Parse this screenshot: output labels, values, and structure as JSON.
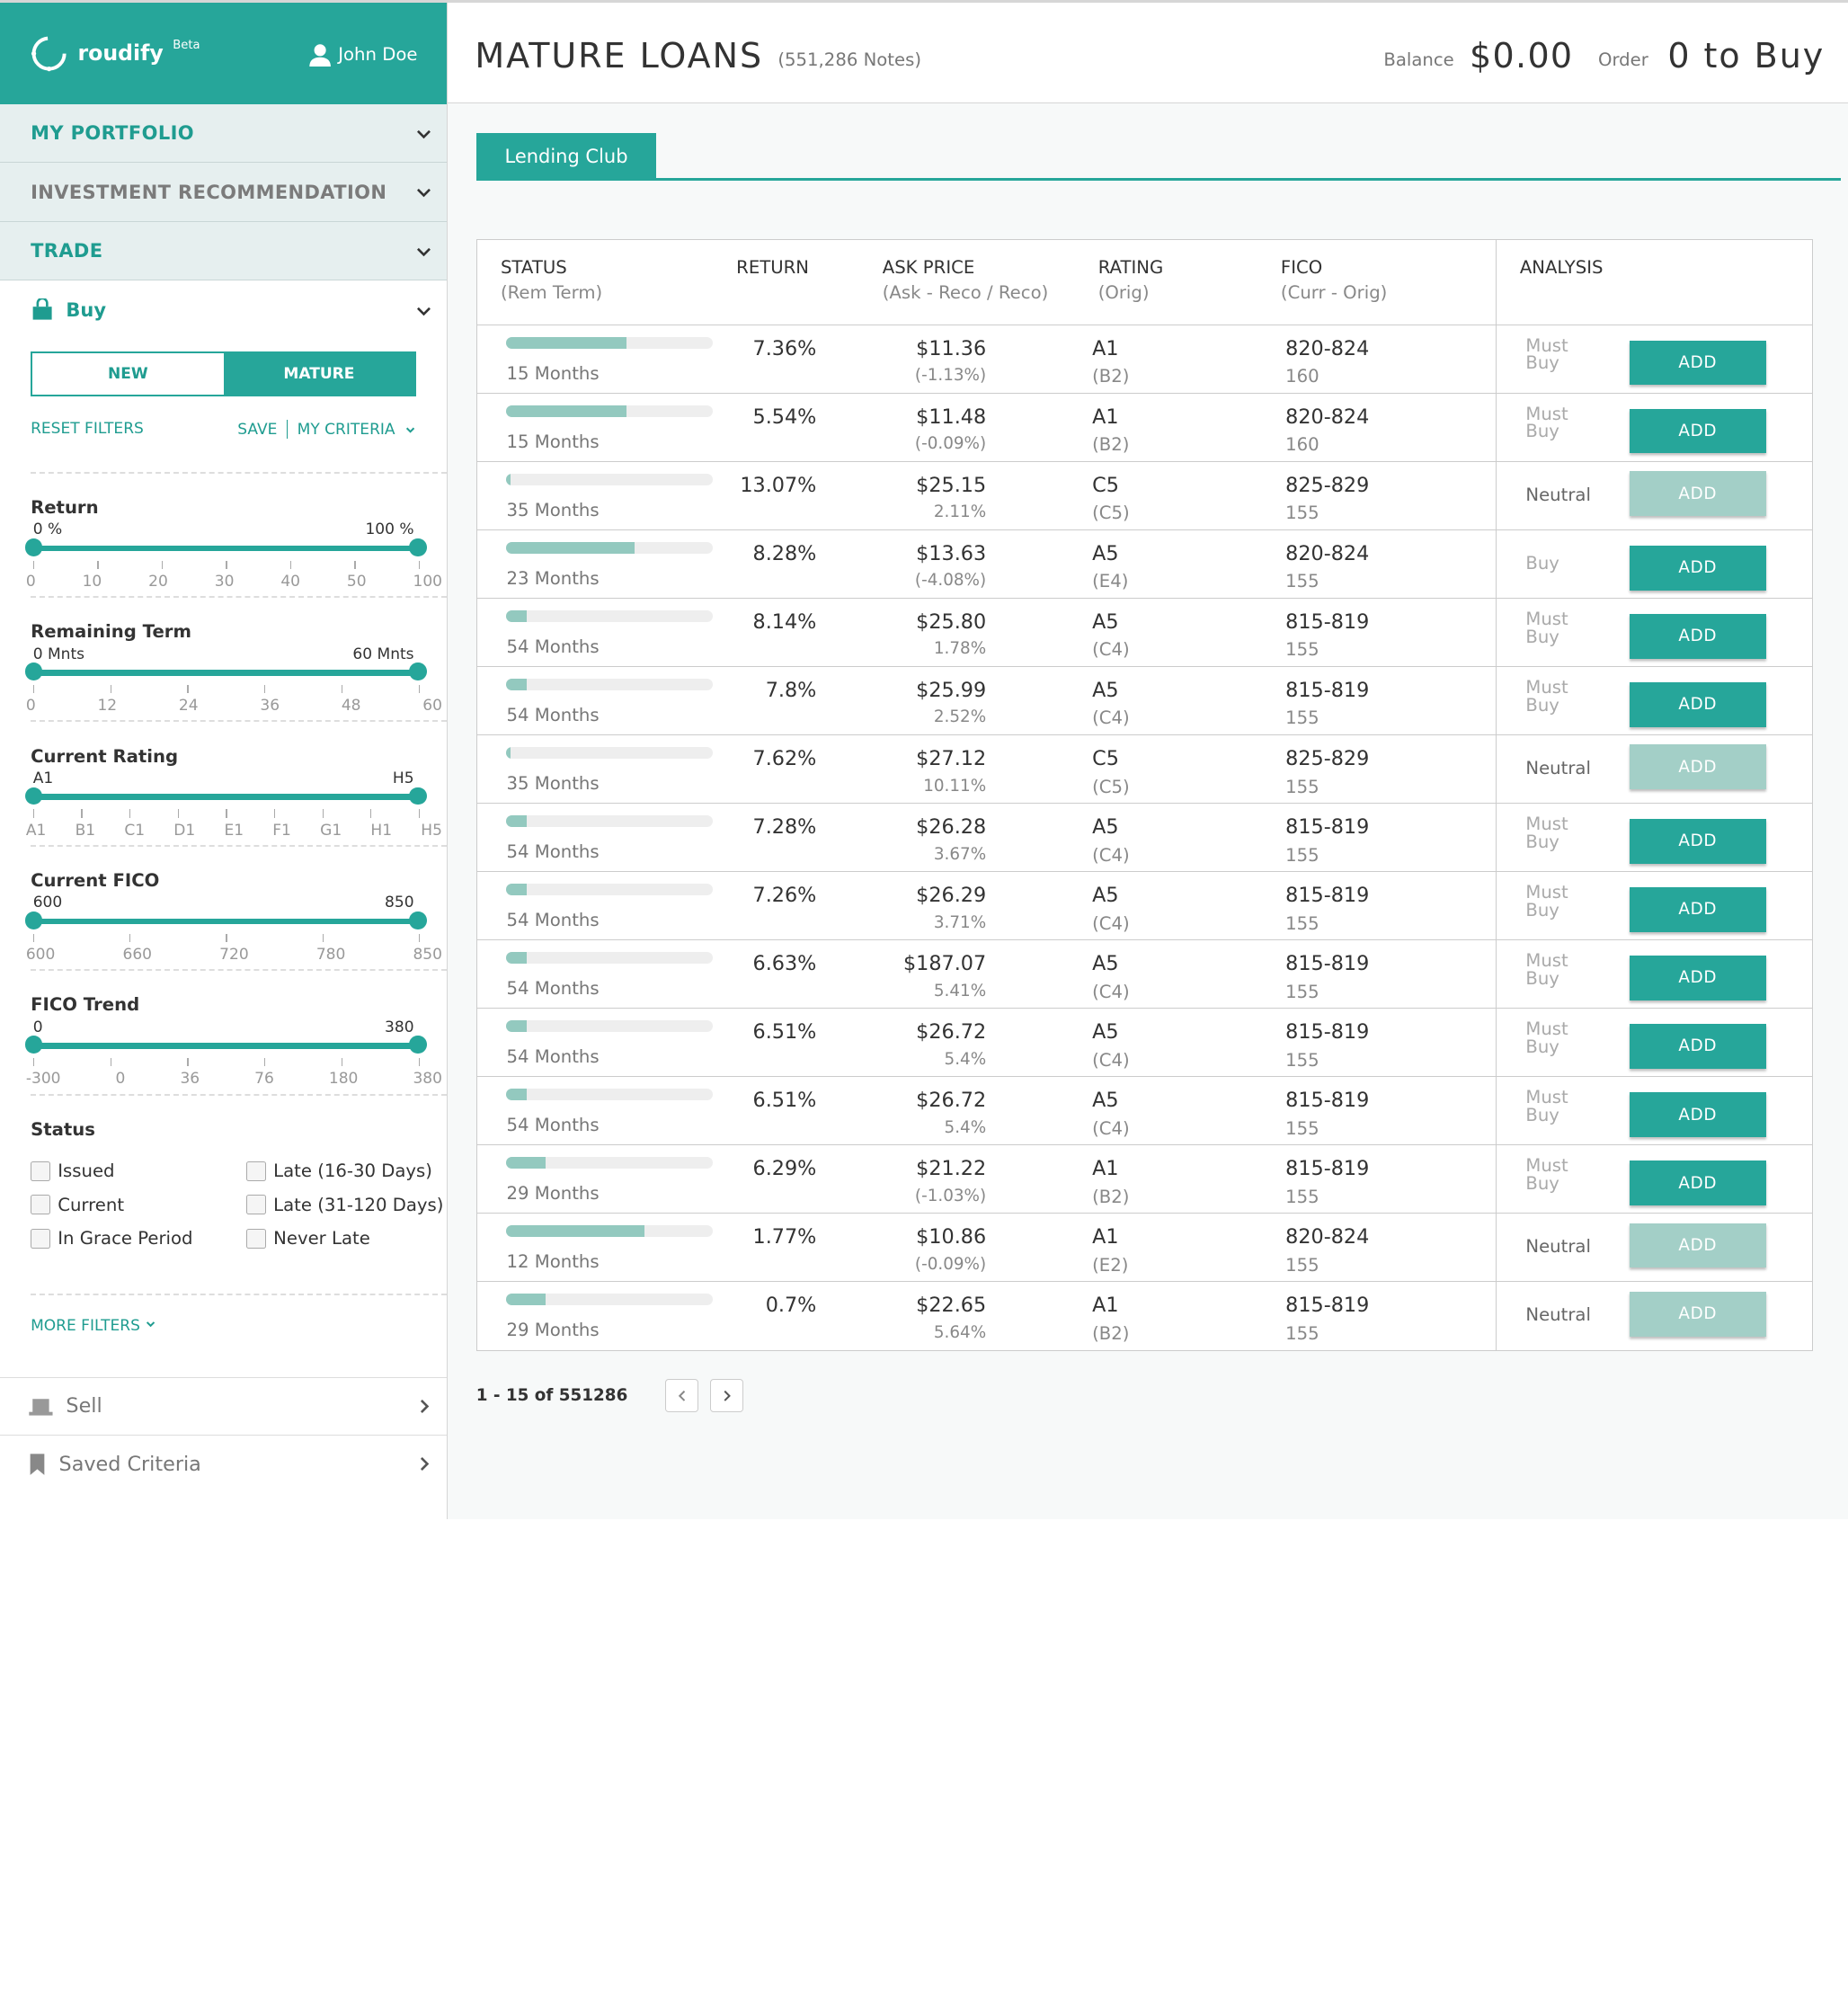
{
  "brand": {
    "name": "roudify",
    "beta": "Beta"
  },
  "user": {
    "name": "John Doe"
  },
  "nav": {
    "portfolio": "MY PORTFOLIO",
    "recommendation": "INVESTMENT RECOMMENDATION",
    "trade": "TRADE",
    "buy": "Buy",
    "sell": "Sell",
    "saved": "Saved Criteria"
  },
  "toggle": {
    "new": "NEW",
    "mature": "MATURE"
  },
  "filters": {
    "reset": "RESET FILTERS",
    "save": "SAVE",
    "criteria": "MY CRITERIA",
    "more": "MORE FILTERS"
  },
  "sliders": [
    {
      "title": "Return",
      "min": "0 %",
      "max": "100 %",
      "labels": [
        "0",
        "10",
        "20",
        "30",
        "40",
        "50",
        "100"
      ]
    },
    {
      "title": "Remaining Term",
      "min": "0 Mnts",
      "max": "60 Mnts",
      "labels": [
        "0",
        "12",
        "24",
        "36",
        "48",
        "60"
      ]
    },
    {
      "title": "Current Rating",
      "min": "A1",
      "max": "H5",
      "labels": [
        "A1",
        "B1",
        "C1",
        "D1",
        "E1",
        "F1",
        "G1",
        "H1",
        "H5"
      ]
    },
    {
      "title": "Current FICO",
      "min": "600",
      "max": "850",
      "labels": [
        "600",
        "660",
        "720",
        "780",
        "850"
      ]
    },
    {
      "title": "FICO Trend",
      "min": "0",
      "max": "380",
      "labels": [
        "-300",
        "0",
        "36",
        "76",
        "180",
        "380"
      ]
    }
  ],
  "status": {
    "title": "Status",
    "options": [
      "Issued",
      "Late (16-30 Days)",
      "Current",
      "Late (31-120 Days)",
      "In Grace Period",
      "Never Late"
    ]
  },
  "header": {
    "title": "MATURE LOANS",
    "count": "(551,286 Notes)",
    "balance_label": "Balance",
    "balance": "$0.00",
    "order_label": "Order",
    "order": "0 to Buy"
  },
  "tab": "Lending Club",
  "columns": {
    "status": "STATUS",
    "status_sub": "(Rem Term)",
    "return": "RETURN",
    "ask": "ASK PRICE",
    "ask_sub": "(Ask - Reco / Reco)",
    "rating": "RATING",
    "rating_sub": "(Orig)",
    "fico": "FICO",
    "fico_sub": "(Curr - Orig)",
    "analysis": "ANALYSIS"
  },
  "add_label": "ADD",
  "rows": [
    {
      "progress": 0.58,
      "term": "15 Months",
      "ret": "7.36%",
      "ask": "$11.36",
      "askd": "(-1.13%)",
      "rating": "A1",
      "orig": "(B2)",
      "fico": "820-824",
      "fico2": "160",
      "analysis": "Must Buy",
      "enabled": true
    },
    {
      "progress": 0.58,
      "term": "15 Months",
      "ret": "5.54%",
      "ask": "$11.48",
      "askd": "(-0.09%)",
      "rating": "A1",
      "orig": "(B2)",
      "fico": "820-824",
      "fico2": "160",
      "analysis": "Must Buy",
      "enabled": true
    },
    {
      "progress": 0.02,
      "term": "35 Months",
      "ret": "13.07%",
      "ask": "$25.15",
      "askd": "2.11%",
      "rating": "C5",
      "orig": "(C5)",
      "fico": "825-829",
      "fico2": "155",
      "analysis": "Neutral",
      "enabled": false
    },
    {
      "progress": 0.62,
      "term": "23 Months",
      "ret": "8.28%",
      "ask": "$13.63",
      "askd": "(-4.08%)",
      "rating": "A5",
      "orig": "(E4)",
      "fico": "820-824",
      "fico2": "155",
      "analysis": "Buy",
      "enabled": true
    },
    {
      "progress": 0.1,
      "term": "54 Months",
      "ret": "8.14%",
      "ask": "$25.80",
      "askd": "1.78%",
      "rating": "A5",
      "orig": "(C4)",
      "fico": "815-819",
      "fico2": "155",
      "analysis": "Must Buy",
      "enabled": true
    },
    {
      "progress": 0.1,
      "term": "54 Months",
      "ret": "7.8%",
      "ask": "$25.99",
      "askd": "2.52%",
      "rating": "A5",
      "orig": "(C4)",
      "fico": "815-819",
      "fico2": "155",
      "analysis": "Must Buy",
      "enabled": true
    },
    {
      "progress": 0.02,
      "term": "35 Months",
      "ret": "7.62%",
      "ask": "$27.12",
      "askd": "10.11%",
      "rating": "C5",
      "orig": "(C5)",
      "fico": "825-829",
      "fico2": "155",
      "analysis": "Neutral",
      "enabled": false
    },
    {
      "progress": 0.1,
      "term": "54 Months",
      "ret": "7.28%",
      "ask": "$26.28",
      "askd": "3.67%",
      "rating": "A5",
      "orig": "(C4)",
      "fico": "815-819",
      "fico2": "155",
      "analysis": "Must Buy",
      "enabled": true
    },
    {
      "progress": 0.1,
      "term": "54 Months",
      "ret": "7.26%",
      "ask": "$26.29",
      "askd": "3.71%",
      "rating": "A5",
      "orig": "(C4)",
      "fico": "815-819",
      "fico2": "155",
      "analysis": "Must Buy",
      "enabled": true
    },
    {
      "progress": 0.1,
      "term": "54 Months",
      "ret": "6.63%",
      "ask": "$187.07",
      "askd": "5.41%",
      "rating": "A5",
      "orig": "(C4)",
      "fico": "815-819",
      "fico2": "155",
      "analysis": "Must Buy",
      "enabled": true
    },
    {
      "progress": 0.1,
      "term": "54 Months",
      "ret": "6.51%",
      "ask": "$26.72",
      "askd": "5.4%",
      "rating": "A5",
      "orig": "(C4)",
      "fico": "815-819",
      "fico2": "155",
      "analysis": "Must Buy",
      "enabled": true
    },
    {
      "progress": 0.1,
      "term": "54 Months",
      "ret": "6.51%",
      "ask": "$26.72",
      "askd": "5.4%",
      "rating": "A5",
      "orig": "(C4)",
      "fico": "815-819",
      "fico2": "155",
      "analysis": "Must Buy",
      "enabled": true
    },
    {
      "progress": 0.19,
      "term": "29 Months",
      "ret": "6.29%",
      "ask": "$21.22",
      "askd": "(-1.03%)",
      "rating": "A1",
      "orig": "(B2)",
      "fico": "815-819",
      "fico2": "155",
      "analysis": "Must Buy",
      "enabled": true
    },
    {
      "progress": 0.67,
      "term": "12 Months",
      "ret": "1.77%",
      "ask": "$10.86",
      "askd": "(-0.09%)",
      "rating": "A1",
      "orig": "(E2)",
      "fico": "820-824",
      "fico2": "155",
      "analysis": "Neutral",
      "enabled": false
    },
    {
      "progress": 0.19,
      "term": "29 Months",
      "ret": "0.7%",
      "ask": "$22.65",
      "askd": "5.64%",
      "rating": "A1",
      "orig": "(B2)",
      "fico": "815-819",
      "fico2": "155",
      "analysis": "Neutral",
      "enabled": false
    }
  ],
  "pager": {
    "text": "1 - 15 of 551286"
  },
  "colors": {
    "accent": "#26a69a",
    "disabled": "#a3cfc7",
    "nav_bg": "#e6efef"
  }
}
